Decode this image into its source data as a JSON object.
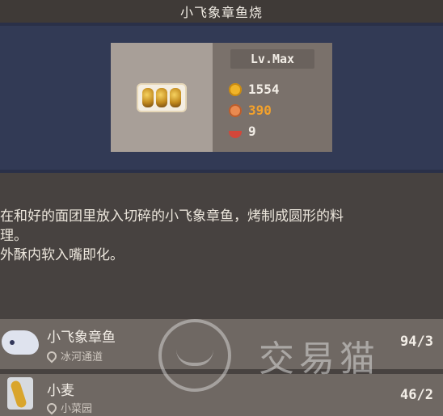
{
  "header": {
    "title": "小飞象章鱼烧"
  },
  "dish": {
    "image_icon": "takoyaki-icon",
    "level": "Lv.Max",
    "price": "1554",
    "popularity": "390",
    "popularity_color": "#f3a12b",
    "servings": "9"
  },
  "description": {
    "line1": "在和好的面团里放入切碎的小飞象章鱼，烤制成圆形的料",
    "line2": "理。",
    "line3": "外酥内软入嘴即化。"
  },
  "ingredients": [
    {
      "name": "小飞象章鱼",
      "location": "冰河通道",
      "count": "94/3",
      "icon": "dumbo-octopus-icon"
    },
    {
      "name": "小麦",
      "location": "小菜园",
      "count": "46/2",
      "icon": "wheat-icon"
    }
  ],
  "watermark": {
    "text": "交易猫",
    "icon": "cat-face-icon"
  }
}
